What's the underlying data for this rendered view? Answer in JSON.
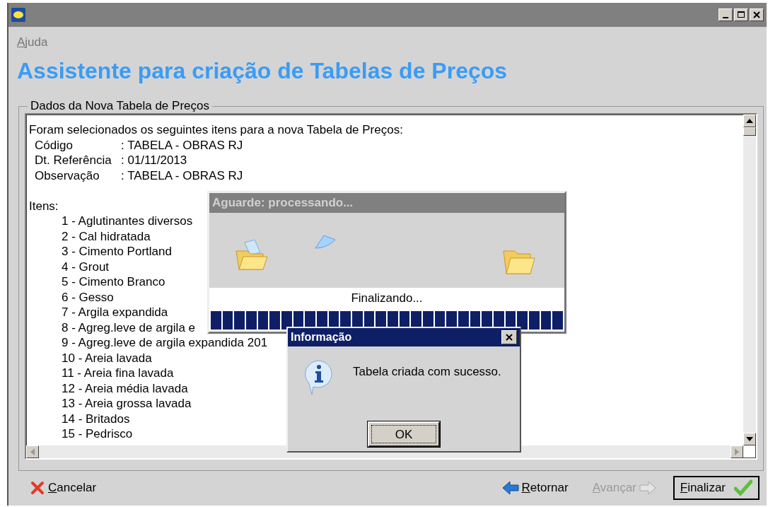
{
  "menu": [
    {
      "label": "Ajuda"
    }
  ],
  "heading": "Assistente para criação de Tabelas de Preços",
  "group": {
    "title": "Dados da Nova Tabela de Preços",
    "intro": "Foram selecionados os seguintes itens para a nova Tabela de Preços:",
    "fields": [
      {
        "label": "Código",
        "value": ": TABELA - OBRAS RJ"
      },
      {
        "label": "Dt. Referência",
        "value": ": 01/11/2013"
      },
      {
        "label": "Observação",
        "value": ": TABELA - OBRAS RJ"
      }
    ],
    "items_label": "Itens:",
    "items": [
      "1 - Aglutinantes diversos",
      "2 - Cal hidratada",
      "3 - Cimento Portland",
      "4 - Grout",
      "5 - Cimento Branco",
      "6 - Gesso",
      "7 - Argila expandida",
      "8 - Agreg.leve de argila e",
      "9 - Agreg.leve de argila expandida 201",
      "10 - Areia lavada",
      "11 - Areia fina lavada",
      "12 - Areia média lavada",
      "13 - Areia grossa lavada",
      "14 - Britados",
      "15 - Pedrisco"
    ]
  },
  "progress_dialog": {
    "title": "Aguarde: processando...",
    "status": "Finalizando...",
    "level": 1
  },
  "info_dialog": {
    "title": "Informação",
    "message": "Tabela criada com sucesso.",
    "button": "OK"
  },
  "footer": [
    {
      "kind": "cancel",
      "label": "Cancelar",
      "disabled": false,
      "focused": false
    },
    {
      "kind": "back",
      "label": "Retornar",
      "disabled": false,
      "focused": false
    },
    {
      "kind": "next",
      "label": "Avançar",
      "disabled": true,
      "focused": false
    },
    {
      "kind": "finish",
      "label": "Finalizar",
      "disabled": false,
      "focused": true
    }
  ]
}
